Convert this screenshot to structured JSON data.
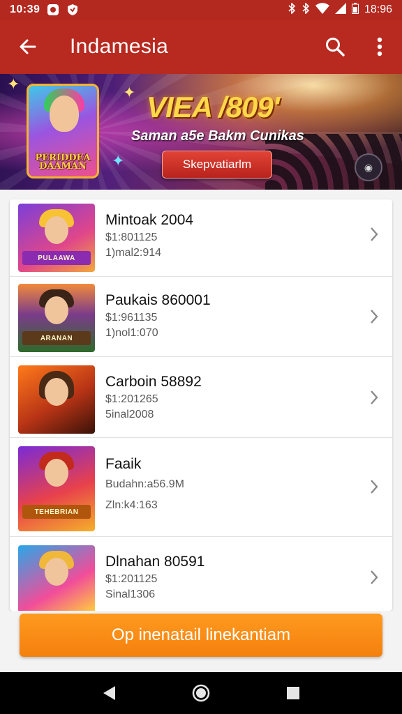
{
  "status_bar": {
    "time": "10:39",
    "right_text": "18:96",
    "icons": [
      "notification-icon",
      "shield-icon",
      "bluetooth-icon",
      "bluetooth-icon",
      "wifi-icon",
      "signal-icon",
      "battery-icon"
    ]
  },
  "app_bar": {
    "title": "Indamesia",
    "icons": [
      "arrow-back-icon",
      "search-icon",
      "more-vert-icon"
    ],
    "color": "#b8291f"
  },
  "banner": {
    "headline": "VIEA /809'",
    "subline": "Saman a5e Bakm Cunikas",
    "cta_label": "Skepvatiarlm",
    "art_logo": "PERIDDEA DAAMAN"
  },
  "items": [
    {
      "name": "Mintoak 2004",
      "line1": "$1:801125",
      "line2": "1)mal2:914",
      "thumb_logo": "PULAAWA"
    },
    {
      "name": "Paukais 860001",
      "line1": "$1:961135",
      "line2": "1)nol1:070",
      "thumb_logo": "ARANAN"
    },
    {
      "name": "Carboin 58892",
      "line1": "$1:201265",
      "line2": "5inal2008",
      "thumb_logo": ""
    },
    {
      "name": "Faaik",
      "line1": "Budahn:a56.9M",
      "line2": "Zln:k4:163",
      "thumb_logo": "TEHEBRIAN"
    },
    {
      "name": "Dlnahan 80591",
      "line1": "$1:201125",
      "line2": "Sinal1306",
      "thumb_logo": ""
    }
  ],
  "primary_button": {
    "label": "Op inenatail linekantiam",
    "color": "#f4800d"
  },
  "nav_bar": {
    "icons": [
      "back-triangle-icon",
      "home-circle-icon",
      "recents-square-icon"
    ]
  }
}
